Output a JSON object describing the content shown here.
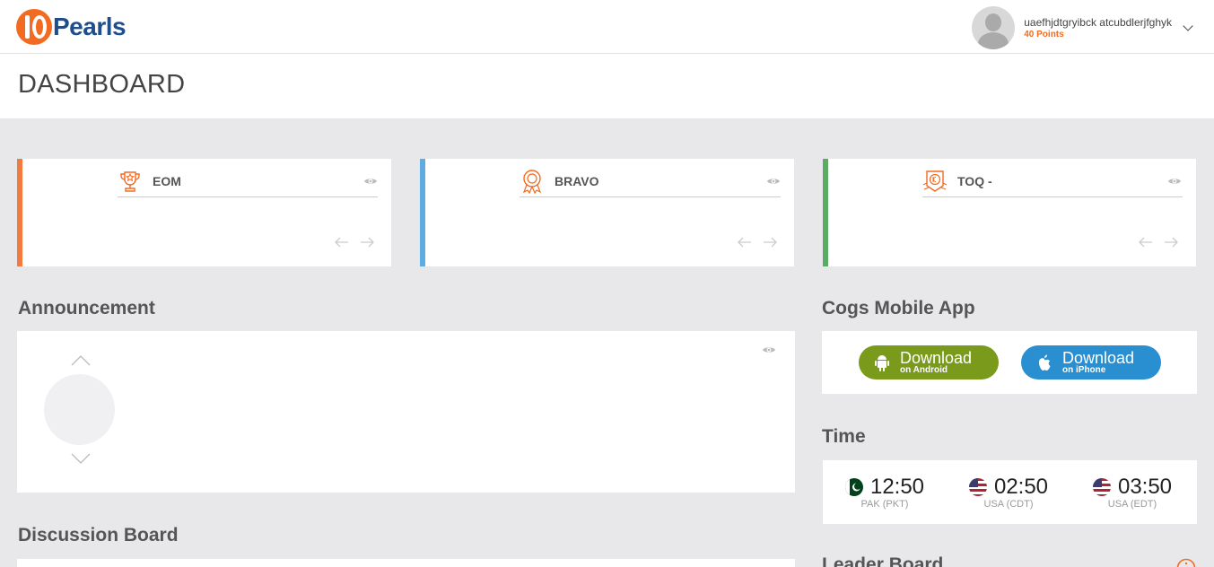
{
  "header": {
    "logo_text": "Pearls",
    "user_name": "uaefhjdtgryibck atcubdlerjfghyk",
    "user_points": "40 Points"
  },
  "page_title": "DASHBOARD",
  "awards": [
    {
      "title": "EOM",
      "accent": "#f37b3f",
      "icon": "trophy-icon"
    },
    {
      "title": "BRAVO",
      "accent": "#5dade2",
      "icon": "medal-icon"
    },
    {
      "title": "TOQ -",
      "accent": "#5aab63",
      "icon": "badge-icon"
    }
  ],
  "announcement": {
    "title": "Announcement"
  },
  "discussion": {
    "title": "Discussion Board"
  },
  "mobile_app": {
    "title": "Cogs Mobile App",
    "android": {
      "label": "Download",
      "sub": "on Android",
      "color": "#7a9a1c"
    },
    "iphone": {
      "label": "Download",
      "sub": "on iPhone",
      "color": "#2a8fd0"
    }
  },
  "time": {
    "title": "Time",
    "zones": [
      {
        "time": "12:50",
        "zone": "PAK (PKT)",
        "flag": "pakistan-flag-icon"
      },
      {
        "time": "02:50",
        "zone": "USA (CDT)",
        "flag": "usa-flag-icon"
      },
      {
        "time": "03:50",
        "zone": "USA (EDT)",
        "flag": "usa-flag-icon"
      }
    ]
  },
  "leader_board": {
    "title": "Leader Board"
  }
}
